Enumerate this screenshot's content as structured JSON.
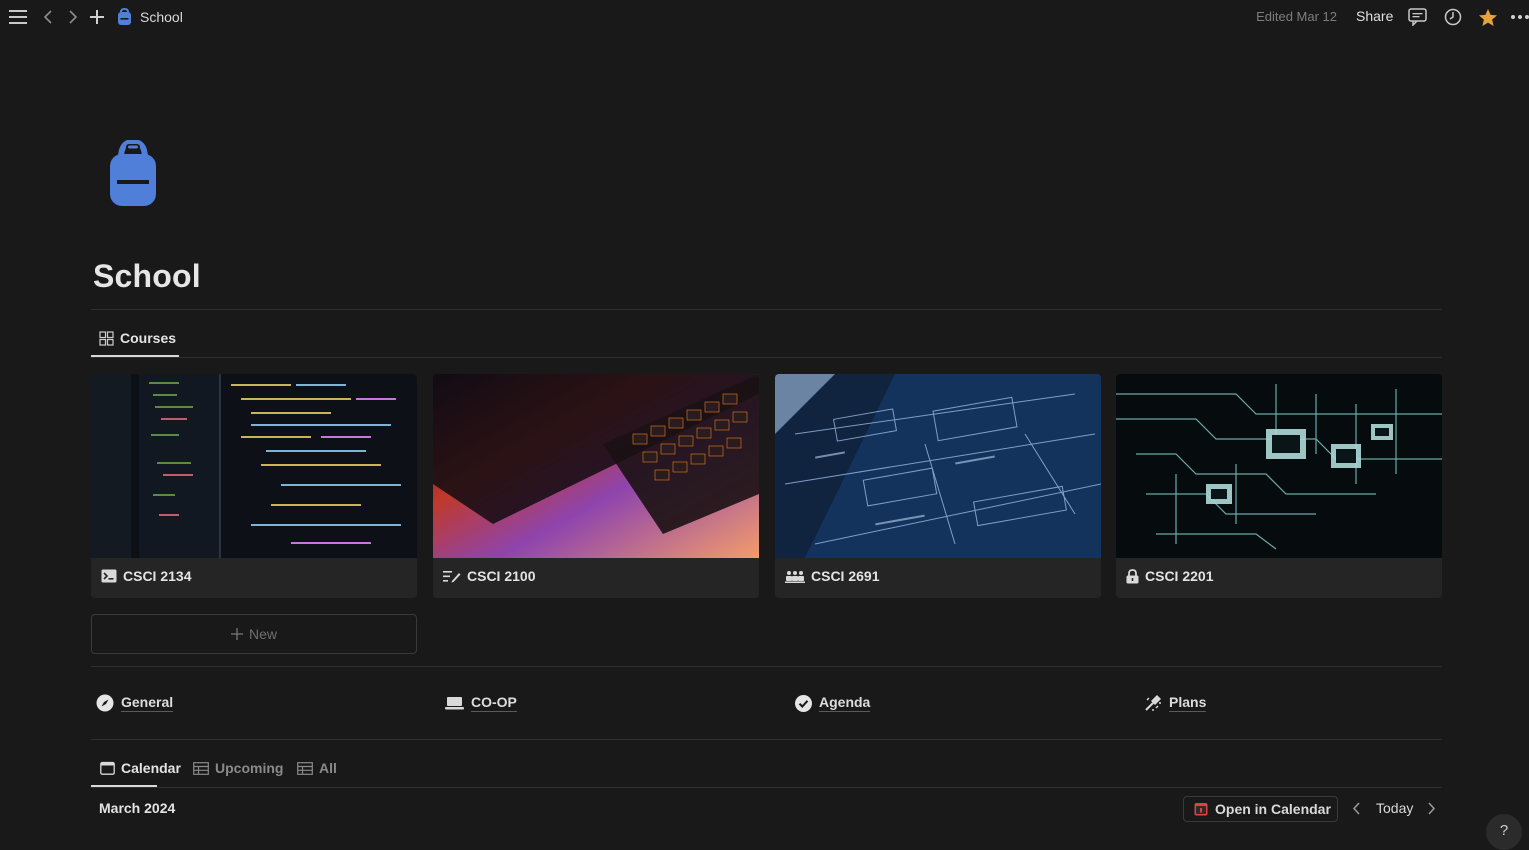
{
  "topbar": {
    "breadcrumb": "School",
    "edited": "Edited Mar 12",
    "share": "Share"
  },
  "page": {
    "icon": "backpack-icon",
    "title": "School"
  },
  "courses_tab": {
    "label": "Courses",
    "icon": "gallery-grid-icon"
  },
  "cards": [
    {
      "label": "CSCI 2134",
      "icon": "terminal-icon"
    },
    {
      "label": "CSCI 2100",
      "icon": "edit-lines-icon"
    },
    {
      "label": "CSCI 2691",
      "icon": "group-icon"
    },
    {
      "label": "CSCI 2201",
      "icon": "lock-icon"
    }
  ],
  "new_label": "New",
  "links": [
    {
      "label": "General",
      "icon": "compass-icon"
    },
    {
      "label": "CO-OP",
      "icon": "laptop-icon"
    },
    {
      "label": "Agenda",
      "icon": "check-circle-icon"
    },
    {
      "label": "Plans",
      "icon": "megaphone-icon"
    }
  ],
  "view_tabs": [
    {
      "label": "Calendar",
      "icon": "calendar-icon",
      "active": true
    },
    {
      "label": "Upcoming",
      "icon": "table-icon",
      "active": false
    },
    {
      "label": "All",
      "icon": "table-icon",
      "active": false
    }
  ],
  "calendar": {
    "month": "March 2024",
    "open_label": "Open in Calendar",
    "today_label": "Today"
  },
  "help_label": "?",
  "colors": {
    "background": "#191919",
    "accent_blue": "#4f7fd9",
    "star": "#e6a23c"
  }
}
